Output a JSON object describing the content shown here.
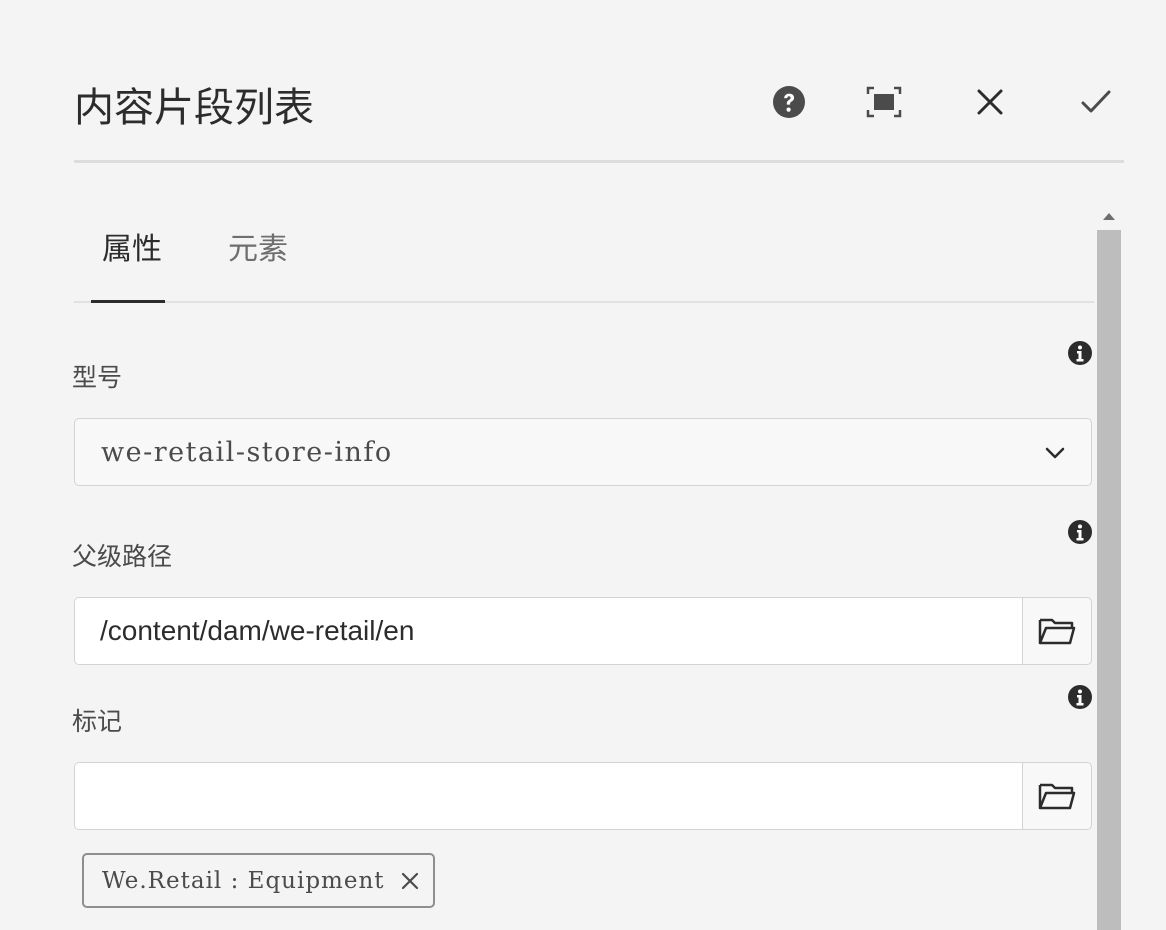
{
  "dialog": {
    "title": "内容片段列表",
    "actions": {
      "help": "help-icon",
      "fullscreen": "fullscreen-icon",
      "cancel": "close-icon",
      "done": "check-icon"
    }
  },
  "tabs": [
    {
      "label": "属性",
      "active": true
    },
    {
      "label": "元素",
      "active": false
    }
  ],
  "fields": {
    "model": {
      "label": "型号",
      "value": "we-retail-store-info"
    },
    "parent_path": {
      "label": "父级路径",
      "value": "/content/dam/we-retail/en"
    },
    "tags": {
      "label": "标记",
      "value": "",
      "selected": [
        {
          "label": "We.Retail : Equipment"
        }
      ]
    }
  },
  "colors": {
    "background": "#f4f4f4",
    "text": "#2c2c2c",
    "scrollbar_thumb": "#bdbdbd"
  }
}
